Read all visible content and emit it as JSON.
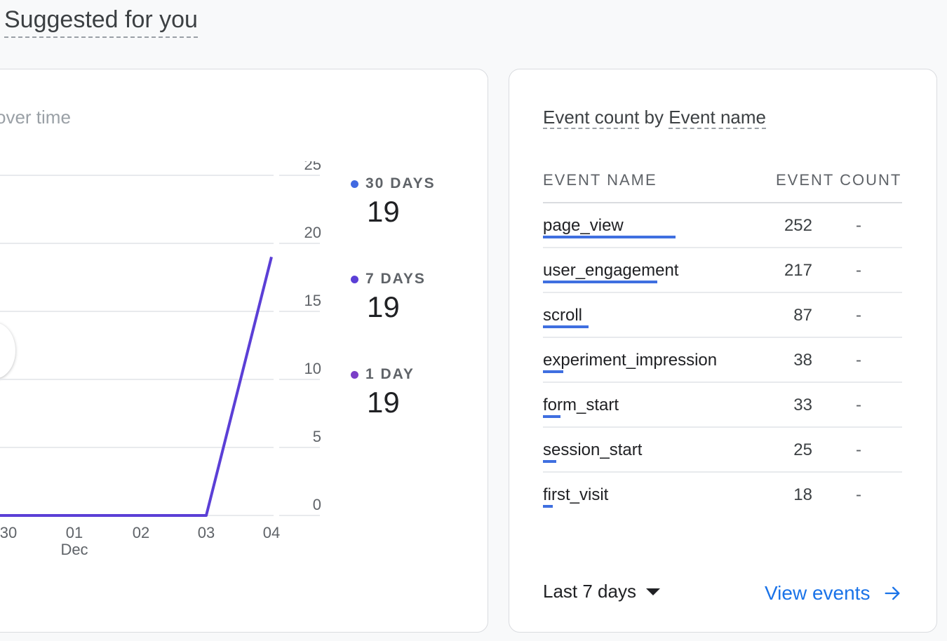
{
  "section_title": "Suggested for you",
  "left_card": {
    "title_fade": "over time",
    "title_main": ""
  },
  "legend": [
    {
      "label": "30 DAYS",
      "value": "19",
      "color": "#4169e1"
    },
    {
      "label": "7 DAYS",
      "value": "19",
      "color": "#5b3fd6"
    },
    {
      "label": "1 DAY",
      "value": "19",
      "color": "#7b3fc7"
    }
  ],
  "chart_data": {
    "type": "line",
    "x": [
      "30",
      "01",
      "02",
      "03",
      "04"
    ],
    "x_sublabel": {
      "01": "Dec"
    },
    "series": [
      {
        "values": [
          0,
          0,
          0,
          0,
          19
        ]
      }
    ],
    "y_ticks": [
      0,
      5,
      10,
      15,
      20,
      25
    ],
    "ylim": [
      0,
      25
    ],
    "grid": true
  },
  "right_card": {
    "title_part1": "Event count",
    "title_by": "by",
    "title_part2": "Event name",
    "col_event_name": "EVENT NAME",
    "col_event_count": "EVENT COUNT",
    "rows": [
      {
        "name": "page_view",
        "count": "252",
        "change": "-"
      },
      {
        "name": "user_engagement",
        "count": "217",
        "change": "-"
      },
      {
        "name": "scroll",
        "count": "87",
        "change": "-"
      },
      {
        "name": "experiment_impression",
        "count": "38",
        "change": "-"
      },
      {
        "name": "form_start",
        "count": "33",
        "change": "-"
      },
      {
        "name": "session_start",
        "count": "25",
        "change": "-"
      },
      {
        "name": "first_visit",
        "count": "18",
        "change": "-"
      }
    ],
    "date_range": "Last 7 days",
    "view_link": "View events"
  }
}
